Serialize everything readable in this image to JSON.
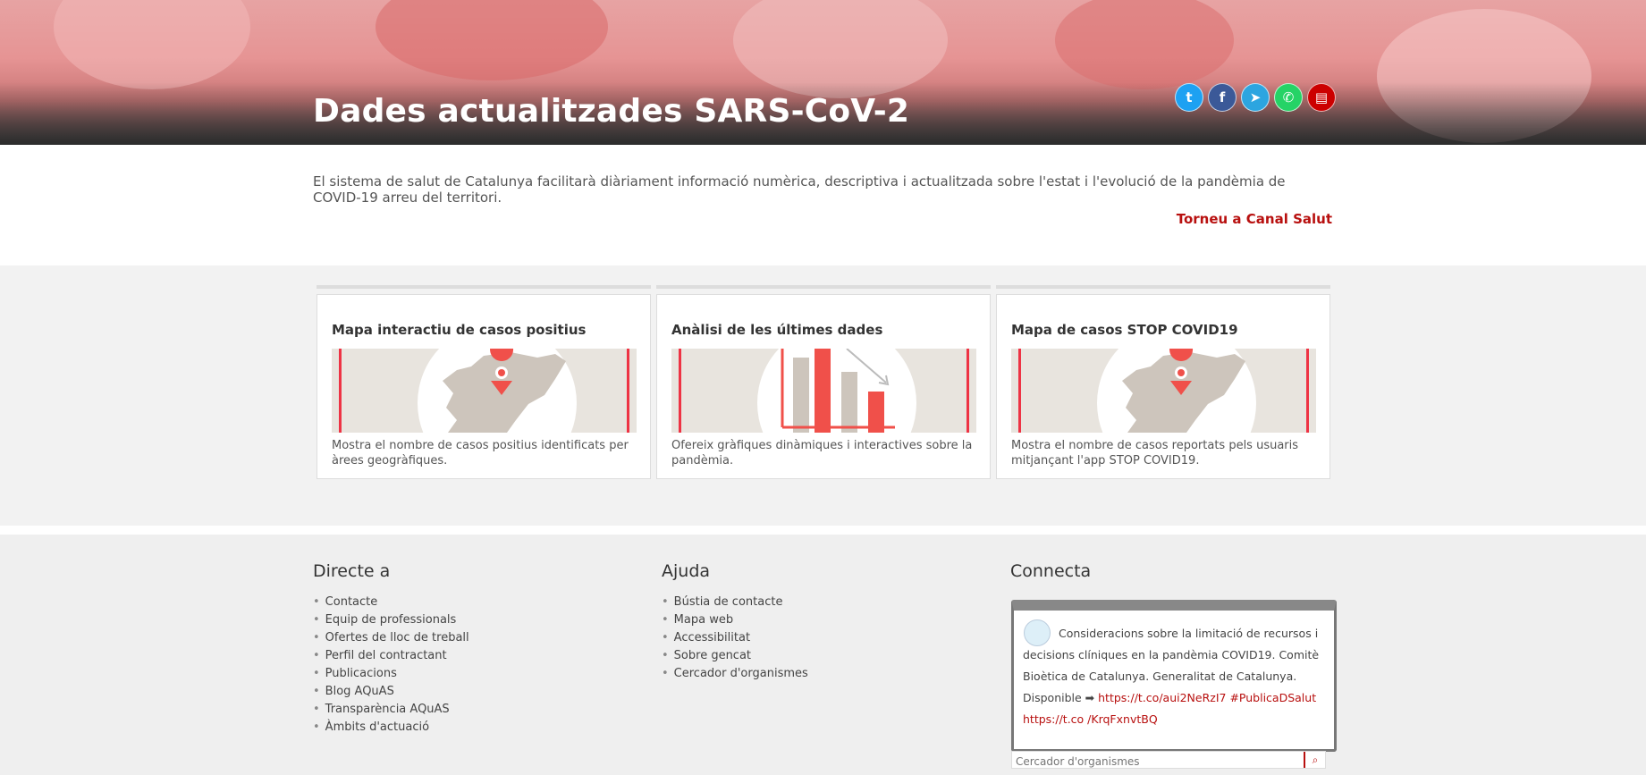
{
  "header": {
    "title": "Dades actualitzades SARS-CoV-2",
    "social": [
      {
        "icon": "twitter-icon",
        "glyph": "t",
        "color": "#1da1f2"
      },
      {
        "icon": "facebook-icon",
        "glyph": "f",
        "color": "#3b5998"
      },
      {
        "icon": "telegram-icon",
        "glyph": "➤",
        "color": "#2ca5e0"
      },
      {
        "icon": "whatsapp-icon",
        "glyph": "✆",
        "color": "#25d366"
      },
      {
        "icon": "print-icon",
        "glyph": "▤",
        "color": "#c00"
      }
    ]
  },
  "intro": {
    "text": "El sistema de salut de Catalunya facilitarà diàriament informació numèrica, descriptiva i actualitzada sobre l'estat i l'evolució de la pandèmia de COVID-19 arreu del territori.",
    "back_link": "Torneu a Canal Salut"
  },
  "cards": [
    {
      "title": "Mapa interactiu de casos positius",
      "desc": "Mostra el nombre de casos positius identificats per àrees geogràfiques.",
      "image": "map-pin"
    },
    {
      "title": "Anàlisi de les últimes dades",
      "desc": "Ofereix gràfiques dinàmiques i interactives sobre la pandèmia.",
      "image": "bar-chart"
    },
    {
      "title": "Mapa de casos STOP COVID19",
      "desc": "Mostra el nombre de casos reportats pels usuaris mitjançant l'app STOP COVID19.",
      "image": "map-pin"
    }
  ],
  "footer": {
    "direct": {
      "heading": "Directe a",
      "items": [
        "Contacte",
        "Equip de professionals",
        "Ofertes de lloc de treball",
        "Perfil del contractant",
        "Publicacions",
        "Blog AQuAS",
        "Transparència AQuAS",
        "Àmbits d'actuació"
      ]
    },
    "help": {
      "heading": "Ajuda",
      "items": [
        "Bústia de contacte",
        "Mapa web",
        "Accessibilitat",
        "Sobre gencat",
        "Cercador d'organismes"
      ]
    },
    "connect": {
      "heading": "Connecta",
      "tweet_text": "Consideracions sobre la limitació de recursos i decisions clíniques en la pandèmia COVID19. Comitè Bioètica de Catalunya. Generalitat de Catalunya. Disponible ➡",
      "tweet_links": "https://t.co/aui2NeRzI7 #PublicaDSalut https://t.co /KrqFxnvtBQ",
      "search_placeholder": "Cercador d'organismes"
    }
  },
  "colors": {
    "accent": "#b8100f",
    "coral": "#f0504a",
    "beige": "#e8e4de"
  }
}
